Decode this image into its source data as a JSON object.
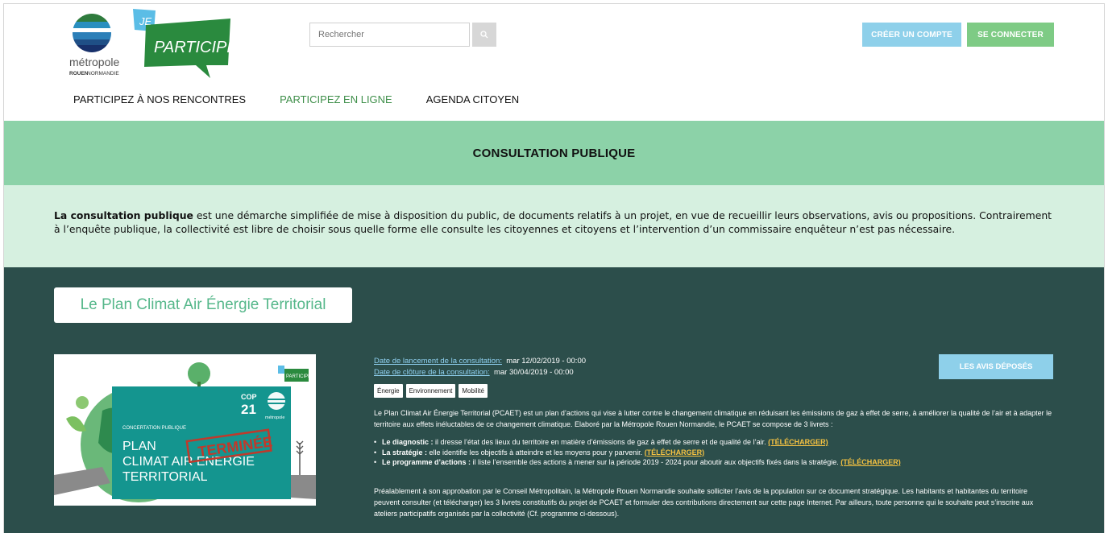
{
  "logo": {
    "metropole": "métropole",
    "rouen": "ROUEN",
    "normandie": "NORMANDIE",
    "je": "JE",
    "participe": "PARTICIPE!"
  },
  "search": {
    "placeholder": "Rechercher"
  },
  "buttons": {
    "create_account": "CRÉER UN COMPTE",
    "login": "SE CONNECTER"
  },
  "nav": [
    {
      "label": "PARTICIPEZ À NOS RENCONTRES"
    },
    {
      "label": "PARTICIPEZ EN LIGNE"
    },
    {
      "label": "AGENDA CITOYEN"
    }
  ],
  "page_title": "CONSULTATION PUBLIQUE",
  "intro": {
    "bold": "La consultation publique",
    "text": " est une démarche simplifiée de mise à disposition du public, de documents relatifs à un projet, en vue de recueillir leurs observations, avis ou propositions. Contrairement à l’enquête publique, la collectivité est libre de choisir sous quelle forme elle consulte les citoyennes et citoyens et l’intervention d’un commissaire enquêteur n’est pas nécessaire."
  },
  "project": {
    "title": "Le Plan Climat Air Énergie Territorial",
    "launch_label": "Date de lancement de la consultation:",
    "launch_value": "mar 12/02/2019 - 00:00",
    "close_label": "Date de clôture de la consultation:",
    "close_value": "mar 30/04/2019 - 00:00",
    "tags": [
      "Énergie",
      "Environnement",
      "Mobilité"
    ],
    "avis_button": "LES AVIS DÉPOSÉS",
    "poster": {
      "cop": "COP",
      "cop_num": "21",
      "metropole": "métropole",
      "badge": "PARTICIPE!",
      "kicker": "CONCERTATION PUBLIQUE",
      "line1": "PLAN",
      "line2": "CLIMAT AIR ENERGIE",
      "line3": "TERRITORIAL",
      "stamp": "TERMINÉE"
    },
    "desc_intro": "Le Plan Climat Air Énergie Territorial (PCAET) est un plan d’actions qui vise à lutter contre le changement climatique en réduisant les émissions de gaz à effet de serre, à améliorer la qualité de l’air et à adapter le territoire aux effets inéluctables de ce changement climatique. Elaboré par la Métropole Rouen Normandie, le PCAET se compose de 3 livrets :",
    "bullets": [
      {
        "bold": "Le diagnostic :",
        "text": " il dresse l’état des lieux du territoire en matière d’émissions de gaz à effet de serre et de qualité de l’air. ",
        "link": "(TÉLÉCHARGER)"
      },
      {
        "bold": "La stratégie :",
        "text": " elle identifie les objectifs à atteindre et les moyens pour y parvenir. ",
        "link": "(TÉLÉCHARGER)"
      },
      {
        "bold": "Le programme d’actions :",
        "text": " il liste l’ensemble des actions à mener sur la période 2019 - 2024 pour aboutir aux objectifs fixés dans la stratégie. ",
        "link": "(TÉLÉCHARGER)"
      }
    ],
    "desc_outro": "Préalablement à son approbation par le Conseil Métropolitain, la Métropole Rouen Normandie souhaite solliciter l’avis de la population sur ce document stratégique. Les habitants et habitantes du territoire peuvent consulter (et télécharger) les 3 livrets constitutifs du projet de PCAET et formuler des contributions directement sur cette page Internet.  Par ailleurs, toute personne qui le souhaite peut s’inscrire aux ateliers participatifs organisés par la collectivité (Cf. programme ci-dessous)."
  }
}
